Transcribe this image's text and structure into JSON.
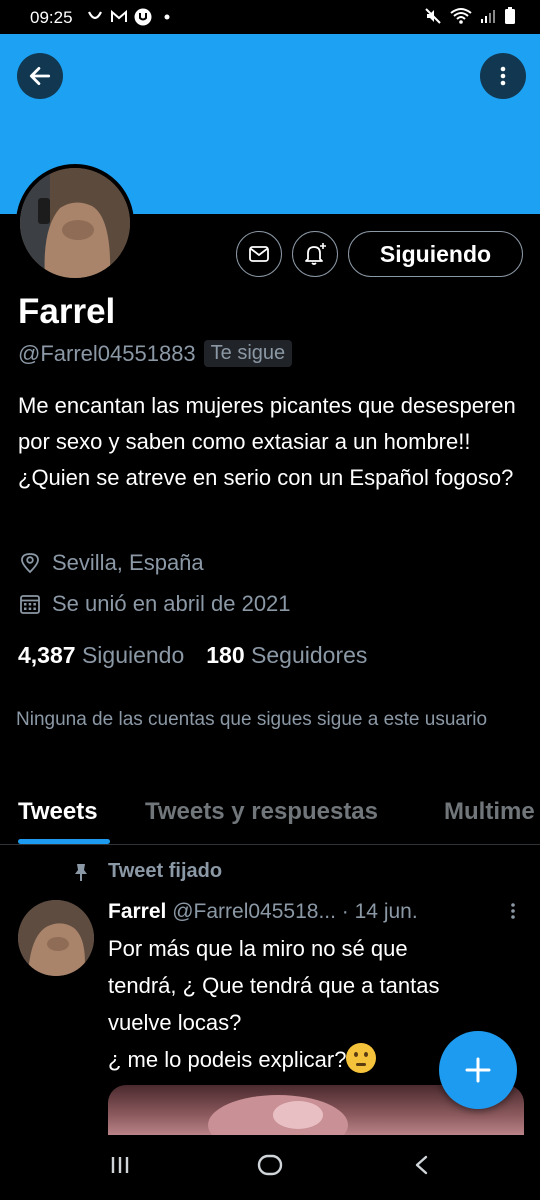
{
  "status_bar": {
    "time": "09:25"
  },
  "profile": {
    "name": "Farrel",
    "handle": "@Farrel04551883",
    "follows_you": "Te sigue",
    "follow_button": "Siguiendo",
    "bio": "Me encantan las mujeres picantes que desesperen por sexo y saben como extasiar a un hombre!! ¿Quien se atreve en serio con un Español fogoso?",
    "location": "Sevilla, España",
    "joined": "Se unió en abril de 2021",
    "following_count": "4,387",
    "following_label": "Siguiendo",
    "followers_count": "180",
    "followers_label": "Seguidores",
    "mutual_note": "Ninguna de las cuentas que sigues sigue a este usuario"
  },
  "tabs": [
    {
      "label": "Tweets",
      "active": true
    },
    {
      "label": "Tweets y respuestas",
      "active": false
    },
    {
      "label": "Multime",
      "active": false
    }
  ],
  "pinned_tweet": {
    "pinned_label": "Tweet fijado",
    "author_name": "Farrel",
    "author_handle": "@Farrel045518...",
    "date": "· 14 jun.",
    "text_lines": [
      "Por más que la miro no sé que",
      "tendrá, ¿ Que tendrá que a tantas",
      "vuelve locas?",
      "¿ me lo podeis explicar?"
    ]
  },
  "colors": {
    "banner": "#1da1f2",
    "accent": "#1d9bf0",
    "background": "#000000",
    "secondary_text": "#8b98a5"
  },
  "icons": {
    "back": "arrow-left-icon",
    "more": "more-vertical-icon",
    "message": "mail-icon",
    "notify": "bell-plus-icon",
    "location": "location-pin-icon",
    "calendar": "calendar-icon",
    "pin": "pin-icon",
    "compose": "plus-icon",
    "emoji": "thinking-face-emoji"
  }
}
